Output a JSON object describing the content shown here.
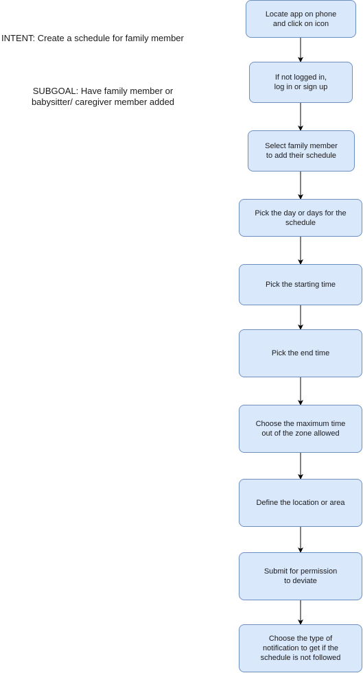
{
  "intent": "INTENT: Create a schedule for family member",
  "subgoal": "SUBGOAL: Have family member or\nbabysitter/ caregiver member added",
  "steps": [
    "Locate app on phone\nand click on icon",
    "If not logged in,\nlog in or sign up",
    "Select family member\nto add their schedule",
    "Pick the day or days for the\nschedule",
    "Pick the starting time",
    "Pick the end time",
    "Choose the maximum time\nout of the zone allowed",
    "Define the location or area",
    "Submit for permission\nto deviate",
    "Choose the type of\nnotification to get if the\nschedule is not followed"
  ],
  "colors": {
    "box_fill": "#dae8fc",
    "box_border": "#6c8ebf",
    "arrow": "#000000"
  }
}
